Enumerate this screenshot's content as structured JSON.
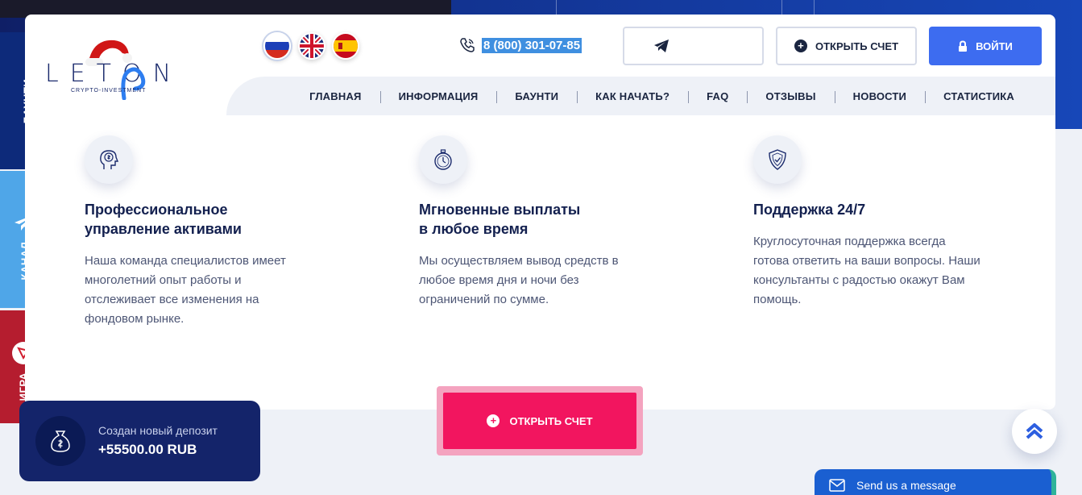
{
  "side_tabs": {
    "bounty_label": "БАУНТИ",
    "channel_label": "КАНАЛ",
    "game_label": "ИГРА"
  },
  "logo": {
    "word": "LETON",
    "subtitle": "CRYPTO-INVESTMENT"
  },
  "languages": [
    "ru",
    "en",
    "es"
  ],
  "header": {
    "phone": "8 (800) 301-07-85",
    "open_account": "ОТКРЫТЬ СЧЕТ",
    "login": "ВОЙТИ"
  },
  "nav": {
    "items": [
      "ГЛАВНАЯ",
      "ИНФОРМАЦИЯ",
      "БАУНТИ",
      "КАК НАЧАТЬ?",
      "FAQ",
      "ОТЗЫВЫ",
      "НОВОСТИ",
      "СТАТИСТИКА"
    ]
  },
  "features": [
    {
      "icon": "head-dollar-icon",
      "title": "Профессиональное\nуправление активами",
      "text": "Наша команда специалистов имеет\nмноголетний опыт работы и\nотслеживает все изменения на\nфондовом рынке."
    },
    {
      "icon": "stopwatch-icon",
      "title": "Мгновенные выплаты\nв любое время",
      "text": "Мы осуществляем вывод средств в\nлюбое время дня и ночи без\nограничений по сумме."
    },
    {
      "icon": "shield-check-icon",
      "title": "Поддержка 24/7",
      "text": "Круглосуточная поддержка всегда\nготова ответить на ваши вопросы. Наши\nконсультанты с радостью окажут Вам\nпомощь."
    }
  ],
  "cta": {
    "label": "ОТКРЫТЬ СЧЕТ"
  },
  "toast": {
    "title": "Создан новый депозит",
    "amount": "+55500.00 RUB"
  },
  "chat": {
    "label": "Send us a message"
  },
  "colors": {
    "primary": "#3d6cf0",
    "cta": "#f2155f",
    "navy": "#13204f"
  }
}
